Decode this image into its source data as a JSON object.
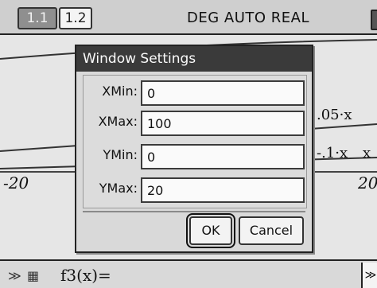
{
  "tabs": [
    "1.1",
    "1.2"
  ],
  "status_bar": {
    "mode": "DEG AUTO REAL"
  },
  "graph": {
    "left_label": "-20",
    "right_label": "20",
    "expr_top": ".05·x",
    "expr_mid": "-.1·x",
    "expr_right_x": "x"
  },
  "dialog": {
    "title": "Window Settings",
    "fields": [
      {
        "label": "XMin:",
        "value": "0"
      },
      {
        "label": "XMax:",
        "value": "100"
      },
      {
        "label": "YMin:",
        "value": "0"
      },
      {
        "label": "YMax:",
        "value": "20"
      }
    ],
    "ok_label": "OK",
    "cancel_label": "Cancel"
  },
  "entry_line": {
    "function_prefix": "f3(x)=",
    "right_glyph": "≫"
  }
}
